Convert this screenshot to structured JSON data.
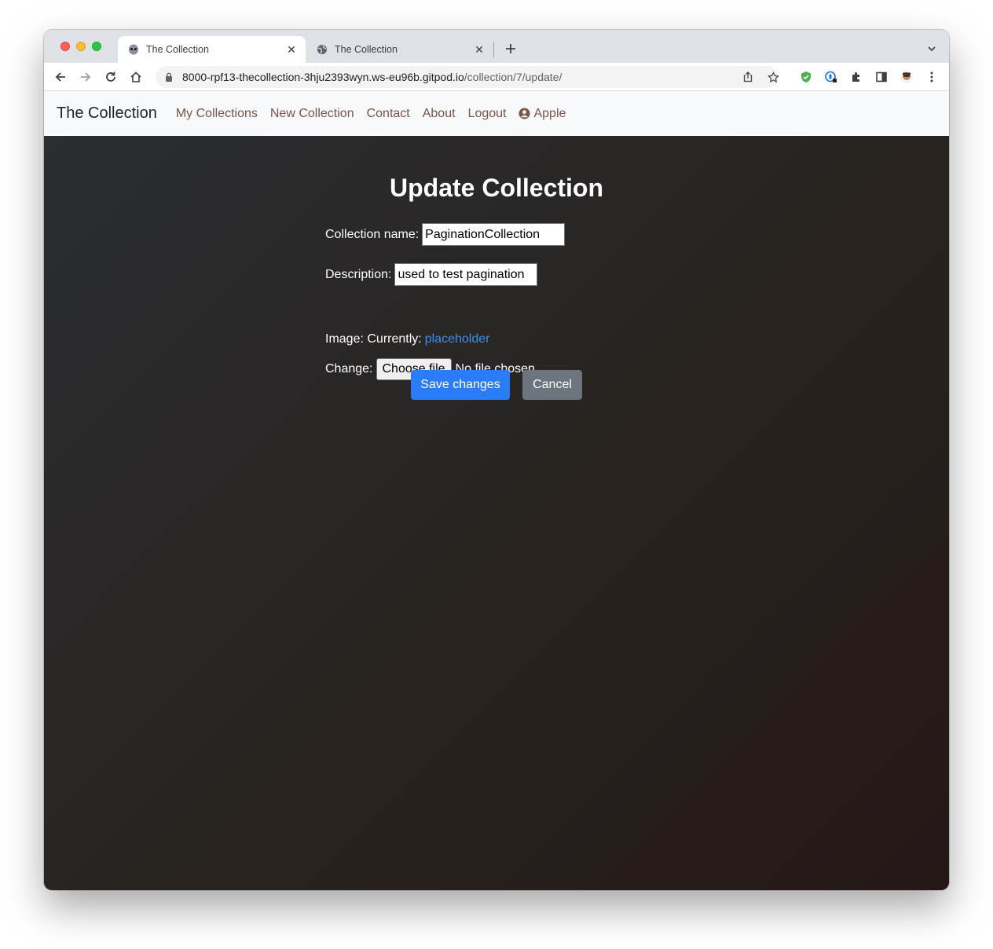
{
  "browser": {
    "tabs": [
      {
        "title": "The Collection",
        "active": true,
        "favicon": "alien-icon"
      },
      {
        "title": "The Collection",
        "active": false,
        "favicon": "globe-icon"
      }
    ],
    "url_host": "8000-rpf13-thecollection-3hju2393wyn.ws-eu96b.gitpod.io",
    "url_path": "/collection/7/update/"
  },
  "navbar": {
    "brand": "The Collection",
    "links": [
      "My Collections",
      "New Collection",
      "Contact",
      "About",
      "Logout"
    ],
    "user": "Apple"
  },
  "form": {
    "title": "Update Collection",
    "name_label": "Collection name:",
    "name_value": "PaginationCollection",
    "description_label": "Description:",
    "description_value": "used to test pagination",
    "image_label": "Image: Currently:",
    "image_link": "placeholder",
    "change_label": "Change:",
    "file_button": "Choose file",
    "file_status": "No file chosen",
    "save_button": "Save changes",
    "cancel_button": "Cancel"
  },
  "colors": {
    "primary": "#2b7cf7",
    "secondary": "#6c757d",
    "nav_link": "#795548",
    "link": "#3b8fe8"
  }
}
